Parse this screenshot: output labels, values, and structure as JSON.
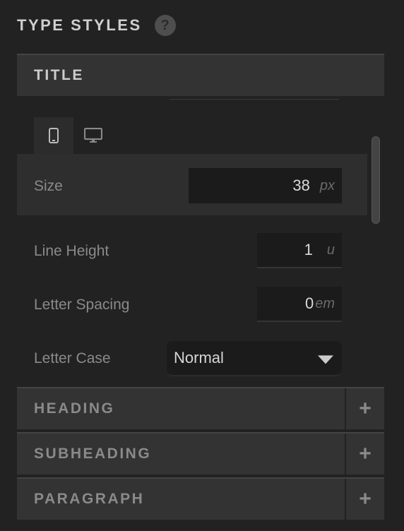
{
  "header": {
    "title": "TYPE STYLES",
    "help_icon": "?"
  },
  "sections": {
    "title": {
      "label": "TITLE",
      "expanded": true
    },
    "heading": {
      "label": "HEADING",
      "expanded": false,
      "action_icon": "+"
    },
    "subheading": {
      "label": "SUBHEADING",
      "expanded": false,
      "action_icon": "+"
    },
    "paragraph": {
      "label": "PARAGRAPH",
      "expanded": false,
      "action_icon": "+"
    }
  },
  "device_tabs": [
    {
      "name": "mobile",
      "icon": "mobile-phone-icon",
      "active": true
    },
    {
      "name": "desktop",
      "icon": "desktop-monitor-icon",
      "active": false
    }
  ],
  "properties": {
    "size": {
      "label": "Size",
      "value": "38",
      "unit": "px"
    },
    "line_height": {
      "label": "Line Height",
      "value": "1",
      "unit": "u"
    },
    "letter_spacing": {
      "label": "Letter Spacing",
      "value": "0",
      "unit": "em"
    },
    "letter_case": {
      "label": "Letter Case",
      "value": "Normal"
    }
  },
  "colors": {
    "background": "#222222",
    "panel": "#333333",
    "input": "#1b1b1b"
  }
}
